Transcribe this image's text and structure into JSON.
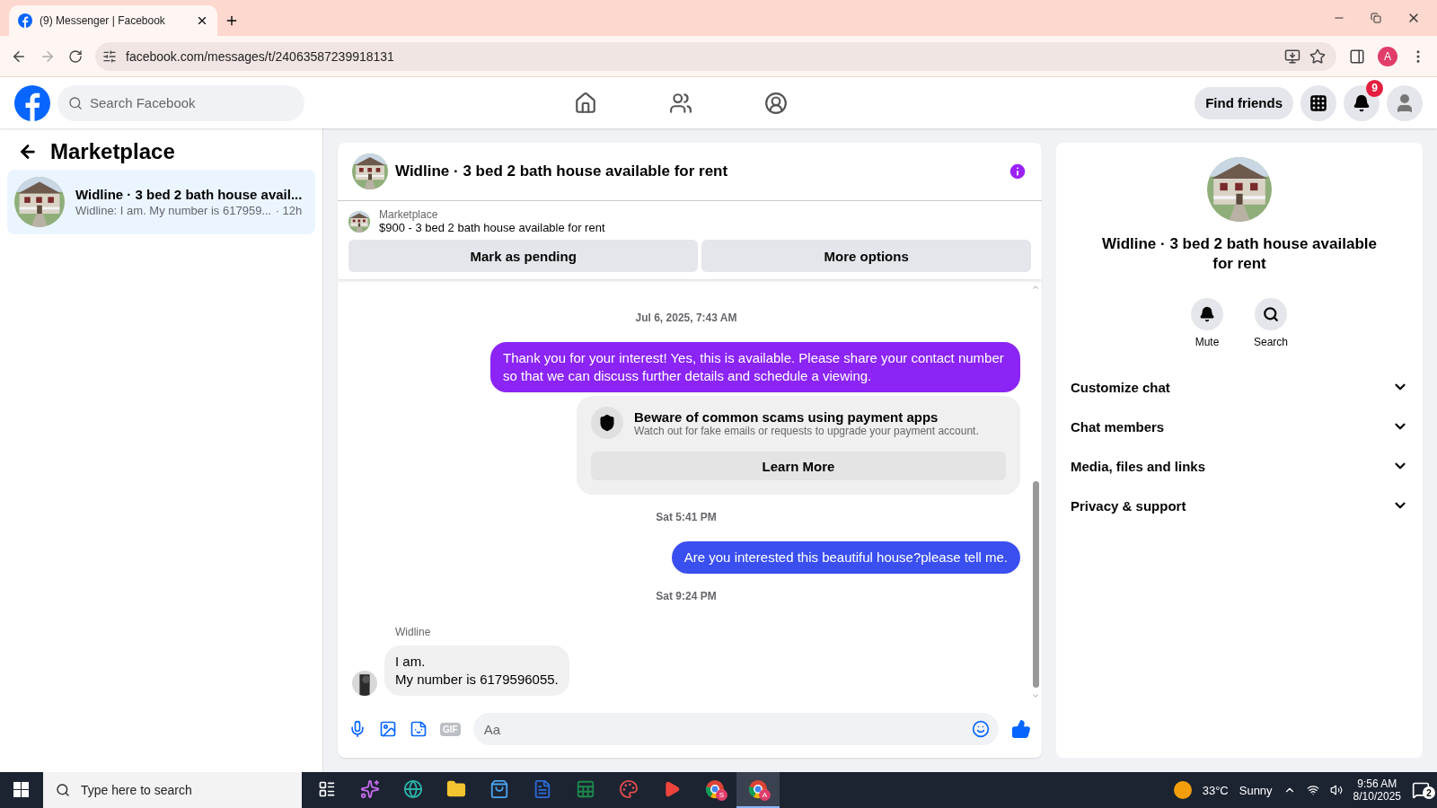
{
  "browser": {
    "tab_title": "(9) Messenger | Facebook",
    "url": "facebook.com/messages/t/24063587239918131",
    "profile_initial": "A"
  },
  "header": {
    "search_placeholder": "Search Facebook",
    "find_friends": "Find friends",
    "notification_count": "9"
  },
  "sidebar": {
    "title": "Marketplace",
    "conversations": [
      {
        "title": "Widline · 3 bed 2 bath house avail...",
        "preview": "Widline: I am. My number is 617959...",
        "time": "· 12h",
        "selected": true
      }
    ]
  },
  "chat": {
    "title": "Widline · 3 bed 2 bath house available for rent",
    "listing": {
      "label": "Marketplace",
      "text": "$900 - 3 bed 2 bath house available for rent"
    },
    "actions": [
      "Mark as pending",
      "More options"
    ],
    "messages": [
      {
        "kind": "timestamp",
        "text": "Jul 6, 2025, 7:43 AM"
      },
      {
        "kind": "outgoing",
        "text": "Thank you for your interest! Yes, this is available. Please share your contact number so that we can discuss further details and schedule a viewing.",
        "color": "#8b24f4"
      },
      {
        "kind": "notice",
        "title": "Beware of common scams using payment apps",
        "text": "Watch out for fake emails or requests to upgrade your payment account.",
        "button": "Learn More"
      },
      {
        "kind": "timestamp",
        "text": "Sat 5:41 PM"
      },
      {
        "kind": "outgoing",
        "text": "Are you interested this beautiful house?please tell me.",
        "color": "#3a4ff0"
      },
      {
        "kind": "timestamp",
        "text": "Sat 9:24 PM"
      },
      {
        "kind": "incoming",
        "sender": "Widline",
        "lines": [
          "I am.",
          "My number is 6179596055."
        ]
      }
    ],
    "composer": {
      "placeholder": "Aa",
      "gif_label": "GIF"
    }
  },
  "details": {
    "title": "Widline · 3 bed 2 bath house available for rent",
    "actions": [
      {
        "kind": "mute",
        "label": "Mute"
      },
      {
        "kind": "search",
        "label": "Search"
      }
    ],
    "sections": [
      {
        "label": "Customize chat",
        "expanded": false
      },
      {
        "label": "Chat members",
        "expanded": false
      },
      {
        "label": "Media, files and links",
        "expanded": false
      },
      {
        "label": "Privacy & support",
        "expanded": false
      }
    ]
  },
  "taskbar": {
    "search_placeholder": "Type here to search",
    "apps": [
      {
        "kind": "tasks"
      },
      {
        "kind": "copilot"
      },
      {
        "kind": "edge"
      },
      {
        "kind": "files"
      },
      {
        "kind": "store"
      },
      {
        "kind": "word"
      },
      {
        "kind": "excel"
      },
      {
        "kind": "paint"
      },
      {
        "kind": "anydesk"
      },
      {
        "kind": "chrome",
        "badge": "S",
        "selected": false
      },
      {
        "kind": "chrome",
        "badge": "A",
        "selected": true
      }
    ],
    "temperature": "33°C",
    "condition": "Sunny",
    "time": "9:56 AM",
    "date": "8/10/2025",
    "notification_count": "2"
  }
}
